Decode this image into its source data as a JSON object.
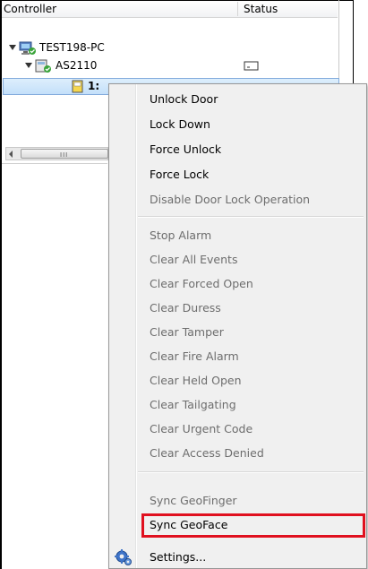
{
  "tree": {
    "columns": {
      "controller": "Controller",
      "status": "Status"
    },
    "nodes": [
      {
        "label": "TEST198-PC"
      },
      {
        "label": "AS2110"
      },
      {
        "label": "1:"
      }
    ]
  },
  "scrollbar": {
    "grip": "III"
  },
  "context_menu": {
    "items": [
      {
        "label": "Unlock Door",
        "enabled": true
      },
      {
        "label": "Lock Down",
        "enabled": true
      },
      {
        "label": "Force Unlock",
        "enabled": true
      },
      {
        "label": "Force Lock",
        "enabled": true
      },
      {
        "label": "Disable Door Lock Operation",
        "enabled": false
      },
      {
        "label": "Stop Alarm",
        "enabled": false
      },
      {
        "label": "Clear All Events",
        "enabled": false
      },
      {
        "label": "Clear Forced Open",
        "enabled": false
      },
      {
        "label": "Clear Duress",
        "enabled": false
      },
      {
        "label": "Clear Tamper",
        "enabled": false
      },
      {
        "label": "Clear Fire Alarm",
        "enabled": false
      },
      {
        "label": "Clear Held Open",
        "enabled": false
      },
      {
        "label": "Clear Tailgating",
        "enabled": false
      },
      {
        "label": "Clear Urgent Code",
        "enabled": false
      },
      {
        "label": "Clear Access Denied",
        "enabled": false
      },
      {
        "label": "Sync GeoFinger",
        "enabled": false
      },
      {
        "label": "Sync GeoFace",
        "enabled": true,
        "highlighted": true
      },
      {
        "label": "Settings...",
        "enabled": true,
        "icon": "gear-icon"
      }
    ]
  },
  "colors": {
    "highlight_border": "#e0101f",
    "selection": "#c4e0fa"
  }
}
